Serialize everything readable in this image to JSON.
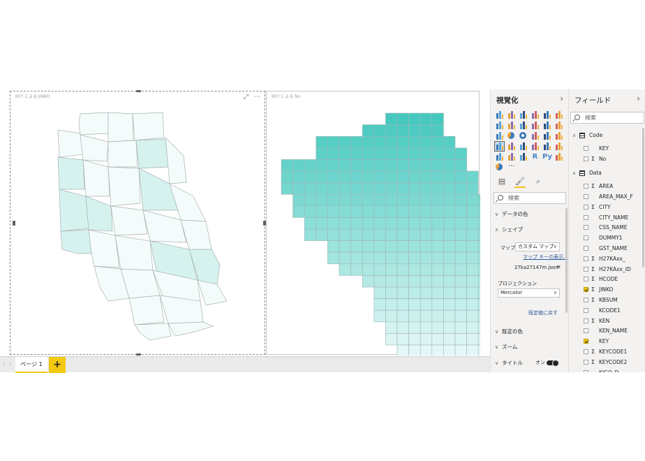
{
  "canvas": {
    "left_visual": {
      "title": "KEY による JINKO"
    },
    "right_visual": {
      "title": "KEY による No"
    },
    "map_colors": {
      "light": "#f3fcfb",
      "mid": "#d6f2ef",
      "dark": "#45c9bf",
      "border": "#a9b2b1"
    },
    "grid_map": {
      "rows": [
        [
          7,
          15
        ],
        [
          7,
          15
        ],
        [
          3,
          15
        ],
        [
          3,
          16
        ],
        [
          0,
          16
        ],
        [
          0,
          17
        ],
        [
          0,
          17
        ],
        [
          1,
          18
        ],
        [
          1,
          18
        ],
        [
          2,
          18
        ],
        [
          2,
          19
        ],
        [
          4,
          19
        ],
        [
          4,
          19
        ],
        [
          5,
          19
        ],
        [
          7,
          20
        ],
        [
          8,
          20
        ],
        [
          8,
          20
        ],
        [
          8,
          20
        ],
        [
          9,
          20
        ],
        [
          9,
          20
        ],
        [
          10,
          19
        ],
        [
          11,
          18
        ],
        [
          12,
          17
        ]
      ],
      "top_notch_rows": [
        [
          [
            2,
            3
          ],
          [
            4,
            6
          ],
          [
            7,
            9
          ],
          [
            14,
            15
          ]
        ],
        [
          [
            2,
            5
          ],
          [
            14,
            15
          ]
        ]
      ]
    }
  },
  "page_tabs": {
    "nav_prev": "‹",
    "nav_next": "›",
    "page1": "ページ 1",
    "add": "+"
  },
  "viz_pane": {
    "title": "視覚化",
    "chevron": "›",
    "search_placeholder": "検索",
    "sections": {
      "data_colors": "データの色",
      "shape": "シェイプ",
      "default_colors": "既定の色",
      "zoom": "ズーム",
      "title": "タイトル"
    },
    "shape": {
      "map_label": "マップ",
      "map_value": "カスタム マップ",
      "map_keys_link": "マップ キーの表示...",
      "file_name": "27ka27147m.json",
      "projection_label": "プロジェクション",
      "projection_value": "Mercator",
      "reset_link": "既定値に戻す"
    },
    "title_toggle": "オン"
  },
  "fields_pane": {
    "title": "フィールド",
    "chevron": "›",
    "search_placeholder": "検索",
    "tables": [
      {
        "name": "Code",
        "fields": [
          {
            "name": "KEY",
            "sigma": false,
            "checked": false
          },
          {
            "name": "No",
            "sigma": true,
            "checked": false
          }
        ]
      },
      {
        "name": "Data",
        "fields": [
          {
            "name": "AREA",
            "sigma": true,
            "checked": false
          },
          {
            "name": "AREA_MAX_F",
            "sigma": false,
            "checked": false
          },
          {
            "name": "CITY",
            "sigma": true,
            "checked": false
          },
          {
            "name": "CITY_NAME",
            "sigma": false,
            "checked": false
          },
          {
            "name": "CSS_NAME",
            "sigma": false,
            "checked": false
          },
          {
            "name": "DUMMY1",
            "sigma": false,
            "checked": false
          },
          {
            "name": "GST_NAME",
            "sigma": false,
            "checked": false
          },
          {
            "name": "H27KAxx_",
            "sigma": true,
            "checked": false
          },
          {
            "name": "H27KAxx_ID",
            "sigma": true,
            "checked": false
          },
          {
            "name": "HCODE",
            "sigma": true,
            "checked": false
          },
          {
            "name": "JINKO",
            "sigma": true,
            "checked": true
          },
          {
            "name": "KBSUM",
            "sigma": true,
            "checked": false
          },
          {
            "name": "KCODE1",
            "sigma": false,
            "checked": false
          },
          {
            "name": "KEN",
            "sigma": true,
            "checked": false
          },
          {
            "name": "KEN_NAME",
            "sigma": false,
            "checked": false
          },
          {
            "name": "KEY",
            "sigma": false,
            "checked": true
          },
          {
            "name": "KEYCODE1",
            "sigma": true,
            "checked": false
          },
          {
            "name": "KEYCODE2",
            "sigma": true,
            "checked": false
          },
          {
            "name": "KIGO_D",
            "sigma": false,
            "checked": false
          }
        ]
      }
    ]
  }
}
